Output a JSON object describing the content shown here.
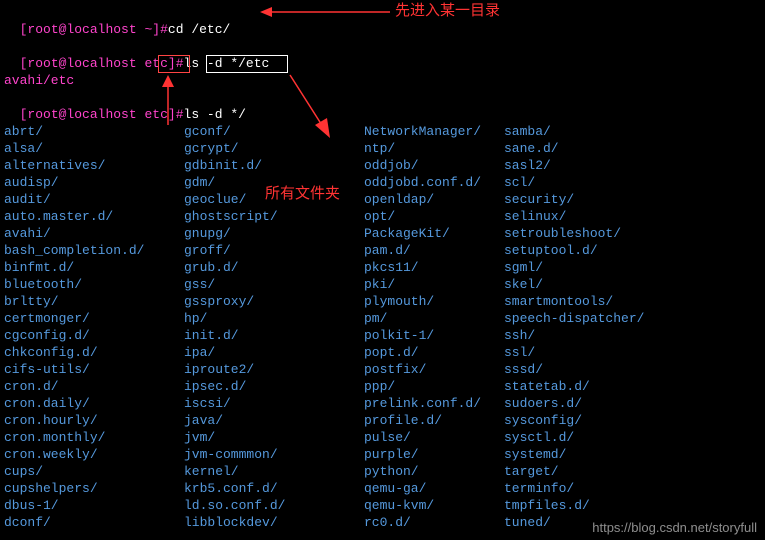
{
  "prompt1": {
    "bracket_open": "[",
    "user": "root",
    "at": "@",
    "host": "localhost",
    "space": " ",
    "path": "~",
    "bracket_close": "]",
    "hash": "#",
    "cmd": "cd /etc/"
  },
  "prompt2": {
    "bracket_open": "[",
    "user": "root",
    "at": "@",
    "host": "localhost",
    "space": " ",
    "path": "etc",
    "bracket_close": "]",
    "hash": "#",
    "cmd": "ls -d */etc"
  },
  "output1": "avahi/etc",
  "prompt3": {
    "bracket_open": "[",
    "user": "root",
    "at": "@",
    "host": "localhost",
    "space": " ",
    "path": "etc",
    "bracket_close": "]",
    "hash": "#",
    "cmd": "ls -d */"
  },
  "columns": {
    "c1": [
      "abrt/",
      "alsa/",
      "alternatives/",
      "audisp/",
      "audit/",
      "auto.master.d/",
      "avahi/",
      "bash_completion.d/",
      "binfmt.d/",
      "bluetooth/",
      "brltty/",
      "certmonger/",
      "cgconfig.d/",
      "chkconfig.d/",
      "cifs-utils/",
      "cron.d/",
      "cron.daily/",
      "cron.hourly/",
      "cron.monthly/",
      "cron.weekly/",
      "cups/",
      "cupshelpers/",
      "dbus-1/",
      "dconf/"
    ],
    "c2": [
      "gconf/",
      "gcrypt/",
      "gdbinit.d/",
      "gdm/",
      "geoclue/",
      "ghostscript/",
      "gnupg/",
      "groff/",
      "grub.d/",
      "gss/",
      "gssproxy/",
      "hp/",
      "init.d/",
      "ipa/",
      "iproute2/",
      "ipsec.d/",
      "iscsi/",
      "java/",
      "jvm/",
      "jvm-commmon/",
      "kernel/",
      "krb5.conf.d/",
      "ld.so.conf.d/",
      "libblockdev/"
    ],
    "c3": [
      "NetworkManager/",
      "ntp/",
      "oddjob/",
      "oddjobd.conf.d/",
      "openldap/",
      "opt/",
      "PackageKit/",
      "pam.d/",
      "pkcs11/",
      "pki/",
      "plymouth/",
      "pm/",
      "polkit-1/",
      "popt.d/",
      "postfix/",
      "ppp/",
      "prelink.conf.d/",
      "profile.d/",
      "pulse/",
      "purple/",
      "python/",
      "qemu-ga/",
      "qemu-kvm/",
      "rc0.d/"
    ],
    "c4": [
      "samba/",
      "sane.d/",
      "sasl2/",
      "scl/",
      "security/",
      "selinux/",
      "setroubleshoot/",
      "setuptool.d/",
      "sgml/",
      "skel/",
      "smartmontools/",
      "speech-dispatcher/",
      "ssh/",
      "ssl/",
      "sssd/",
      "statetab.d/",
      "sudoers.d/",
      "sysconfig/",
      "sysctl.d/",
      "systemd/",
      "target/",
      "terminfo/",
      "tmpfiles.d/",
      "tuned/"
    ]
  },
  "annotations": {
    "top_right": "先进入某一目录",
    "middle": "所有文件夹"
  },
  "watermark": "https://blog.csdn.net/storyfull"
}
